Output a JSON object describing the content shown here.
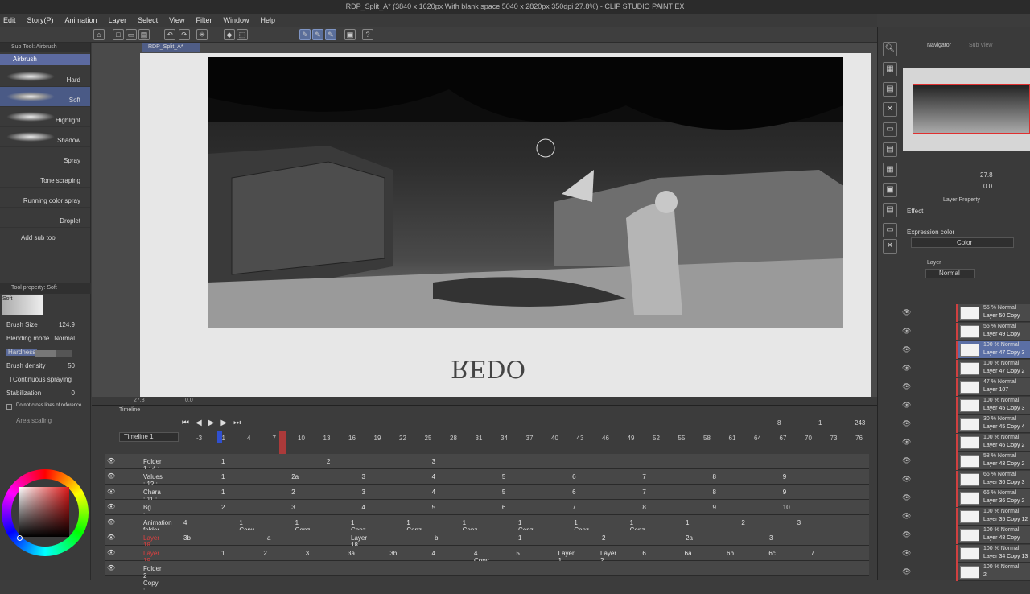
{
  "window": {
    "title": "RDP_Split_A* (3840 x 1620px With blank space:5040 x 2820px 350dpi 27.8%) - CLIP STUDIO PAINT EX"
  },
  "menu": [
    "Edit",
    "Story(P)",
    "Animation",
    "Layer",
    "Select",
    "View",
    "Filter",
    "Window",
    "Help"
  ],
  "toolbar": {
    "icons": [
      "new-icon",
      "open-icon",
      "save-icon",
      "export-icon",
      "undo-icon",
      "redo-icon",
      "transform-icon",
      "fill-icon",
      "select-icon",
      "pen-icon",
      "pencil-icon",
      "brush-icon",
      "frame-icon",
      "help-icon"
    ]
  },
  "subtool": {
    "panel_title": "Sub Tool: Airbrush",
    "group": "Airbrush",
    "brushes": [
      {
        "name": "Hard"
      },
      {
        "name": "Soft"
      },
      {
        "name": "Highlight"
      },
      {
        "name": "Shadow"
      },
      {
        "name": "Spray"
      },
      {
        "name": "Tone scraping"
      },
      {
        "name": "Running color spray"
      },
      {
        "name": "Droplet"
      }
    ],
    "add_label": "Add sub tool"
  },
  "tool_property": {
    "title": "Tool property: Soft",
    "preset": "Soft",
    "brush_size": {
      "label": "Brush Size",
      "value": "124.9"
    },
    "blending_mode": {
      "label": "Blending mode",
      "value": "Normal"
    },
    "hardness": {
      "label": "Hardness",
      "value": "0.55"
    },
    "brush_density": {
      "label": "Brush density",
      "value": "50"
    },
    "continuous_spraying": {
      "label": "Continuous spraying"
    },
    "stabilization": {
      "label": "Stabilization",
      "value": "0"
    },
    "no_cross_lines": {
      "label": "Do not cross lines of reference"
    },
    "area_scaling": {
      "label": "Area scaling"
    }
  },
  "canvas": {
    "tab_label": "RDP_Split_A*",
    "zoom": "27.8",
    "rotation": "0.0",
    "handwriting": "REDO"
  },
  "timeline": {
    "tab": "Timeline",
    "name": "Timeline 1",
    "frame_current": "8",
    "frame_start": "1",
    "frame_end": "243",
    "ruler": [
      "-3",
      "1",
      "4",
      "7",
      "10",
      "13",
      "16",
      "19",
      "22",
      "25",
      "28",
      "31",
      "34",
      "37",
      "40",
      "43",
      "46",
      "49",
      "52",
      "55",
      "58",
      "61",
      "64",
      "67",
      "70",
      "73",
      "76"
    ],
    "tracks": [
      {
        "name": "Folder 1 : 4 : cel",
        "cells": [
          [
            "1"
          ],
          [
            "2"
          ],
          [
            "3"
          ]
        ]
      },
      {
        "name": "Values : 12 : cel",
        "cells": [
          [
            "1"
          ],
          [
            "2a"
          ],
          [
            "3"
          ],
          [
            "4"
          ],
          [
            "5"
          ],
          [
            "6"
          ],
          [
            "7"
          ],
          [
            "8"
          ],
          [
            "9"
          ]
        ]
      },
      {
        "name": "Chara : 11 : cel",
        "cells": [
          [
            "1"
          ],
          [
            "2"
          ],
          [
            "3"
          ],
          [
            "4"
          ],
          [
            "5"
          ],
          [
            "6"
          ],
          [
            "7"
          ],
          [
            "8"
          ],
          [
            "9"
          ]
        ]
      },
      {
        "name": "Bg : 19 : cel",
        "cells": [
          [
            "2"
          ],
          [
            "3"
          ],
          [
            "4"
          ],
          [
            "5"
          ],
          [
            "6"
          ],
          [
            "7"
          ],
          [
            "8"
          ],
          [
            "9"
          ],
          [
            "10"
          ]
        ]
      },
      {
        "name": "Animation folder",
        "cells": [
          [
            "4"
          ],
          [
            "1 Copy"
          ],
          [
            "1 Copz"
          ],
          [
            "1 Copz Copy"
          ],
          [
            "1 Copz Copz"
          ],
          [
            "1 Copz Copz Copy"
          ],
          [
            "1 Copz Copz Copz"
          ],
          [
            "1 Copz Copz Copy"
          ],
          [
            "1 Copz Copz Copz"
          ],
          [
            "1"
          ],
          [
            "2"
          ],
          [
            "3"
          ]
        ]
      },
      {
        "name": "Layer 18",
        "cells": [
          [
            "3b"
          ],
          [
            "a"
          ],
          [
            "Layer 18 Layer 19"
          ],
          [
            "b"
          ],
          [
            "1"
          ],
          [
            "2"
          ],
          [
            "2a"
          ],
          [
            "3"
          ]
        ]
      },
      {
        "name": "Layer 19",
        "cells": [
          [
            "1"
          ],
          [
            "2"
          ],
          [
            "3"
          ],
          [
            "3a"
          ],
          [
            "3b"
          ],
          [
            "4"
          ],
          [
            "4 Copy"
          ],
          [
            "5"
          ],
          [
            "Layer 1"
          ],
          [
            "Layer 2"
          ],
          [
            "6"
          ],
          [
            "6a"
          ],
          [
            "6b"
          ],
          [
            "6c"
          ],
          [
            "7"
          ]
        ]
      },
      {
        "name": "Folder 2 Copy :"
      }
    ]
  },
  "navigator": {
    "tab": "Navigator",
    "tab2": "Sub View",
    "zoom": "27.8",
    "rotation": "0.0"
  },
  "layer_property": {
    "tab": "Layer Property",
    "effect": "Effect",
    "expression_color_label": "Expression color",
    "expression_color": "Color"
  },
  "layers_panel": {
    "tab": "Layer",
    "blend": "Normal",
    "layers": [
      {
        "opacity": "55 % Normal",
        "name": "Layer 50 Copy"
      },
      {
        "opacity": "55 % Normal",
        "name": "Layer 49 Copy"
      },
      {
        "opacity": "100 % Normal",
        "name": "Layer 47 Copy 3"
      },
      {
        "opacity": "100 % Normal",
        "name": "Layer 47 Copy 2"
      },
      {
        "opacity": "47 % Normal",
        "name": "Layer 107"
      },
      {
        "opacity": "100 % Normal",
        "name": "Layer 45 Copy 3"
      },
      {
        "opacity": "30 % Normal",
        "name": "Layer 45 Copy 4"
      },
      {
        "opacity": "100 % Normal",
        "name": "Layer 46 Copy 2"
      },
      {
        "opacity": "58 % Normal",
        "name": "Layer 43 Copy 2"
      },
      {
        "opacity": "66 % Normal",
        "name": "Layer 36 Copy 3"
      },
      {
        "opacity": "66 % Normal",
        "name": "Layer 36 Copy 2"
      },
      {
        "opacity": "100 % Normal",
        "name": "Layer 35 Copy 12"
      },
      {
        "opacity": "100 % Normal",
        "name": "Layer 48 Copy"
      },
      {
        "opacity": "100 % Normal",
        "name": "Layer 34 Copy 13"
      },
      {
        "opacity": "100 % Normal",
        "name": "2"
      }
    ]
  },
  "colors": {
    "accent": "#5b6fa5",
    "playhead": "#d03a3a",
    "layer_mark": "#d04040"
  }
}
